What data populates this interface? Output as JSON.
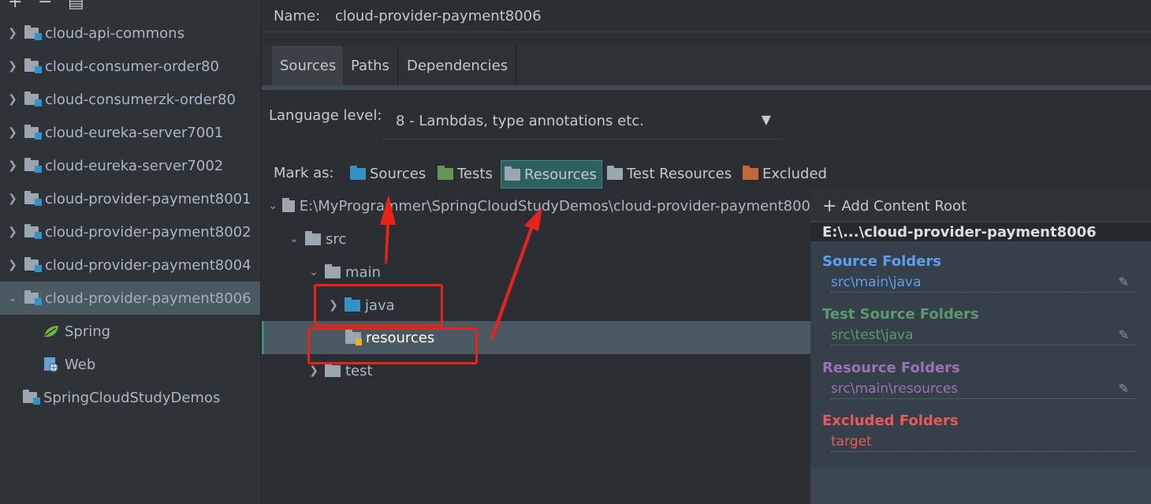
{
  "toolbar": {
    "add": "+",
    "remove": "−",
    "copy": "▤"
  },
  "modules": [
    {
      "label": "cloud-api-commons",
      "expanded": false
    },
    {
      "label": "cloud-consumer-order80",
      "expanded": false
    },
    {
      "label": "cloud-consumerzk-order80",
      "expanded": false
    },
    {
      "label": "cloud-eureka-server7001",
      "expanded": false
    },
    {
      "label": "cloud-eureka-server7002",
      "expanded": false
    },
    {
      "label": "cloud-provider-payment8001",
      "expanded": false
    },
    {
      "label": "cloud-provider-payment8002",
      "expanded": false
    },
    {
      "label": "cloud-provider-payment8004",
      "expanded": false
    },
    {
      "label": "cloud-provider-payment8006",
      "expanded": true,
      "selected": true
    }
  ],
  "facets": [
    {
      "label": "Spring"
    },
    {
      "label": "Web"
    }
  ],
  "root_project": "SpringCloudStudyDemos",
  "name_field": {
    "label": "Name:",
    "value": "cloud-provider-payment8006"
  },
  "tabs": [
    "Sources",
    "Paths",
    "Dependencies"
  ],
  "language_level": {
    "label": "Language level:",
    "value": "8 - Lambdas, type annotations etc."
  },
  "mark_as": {
    "label": "Mark as:",
    "buttons": [
      {
        "label": "Sources",
        "color": "#3592c4"
      },
      {
        "label": "Tests",
        "color": "#629755"
      },
      {
        "label": "Resources",
        "color": "#9aa7b0",
        "active": true
      },
      {
        "label": "Test Resources",
        "color": "#9aa7b0"
      },
      {
        "label": "Excluded",
        "color": "#c4673a"
      }
    ]
  },
  "tree": {
    "root": "E:\\MyProgrammer\\SpringCloudStudyDemos\\cloud-provider-payment800",
    "src": "src",
    "main": "main",
    "java": "java",
    "resources": "resources",
    "test": "test"
  },
  "content_panel": {
    "add_root": "Add Content Root",
    "root_path": "E:\\...\\cloud-provider-payment8006",
    "sections": [
      {
        "title": "Source Folders",
        "item": "src\\main\\java",
        "color": "#5c9fef",
        "editable": true
      },
      {
        "title": "Test Source Folders",
        "item": "src\\test\\java",
        "color": "#5b9a6a",
        "editable": true
      },
      {
        "title": "Resource Folders",
        "item": "src\\main\\resources",
        "color": "#9a74b2",
        "editable": true
      },
      {
        "title": "Excluded Folders",
        "item": "target",
        "color": "#e85a5a",
        "editable": false
      }
    ]
  },
  "colors": {
    "annotation_red": "#e8231b"
  }
}
